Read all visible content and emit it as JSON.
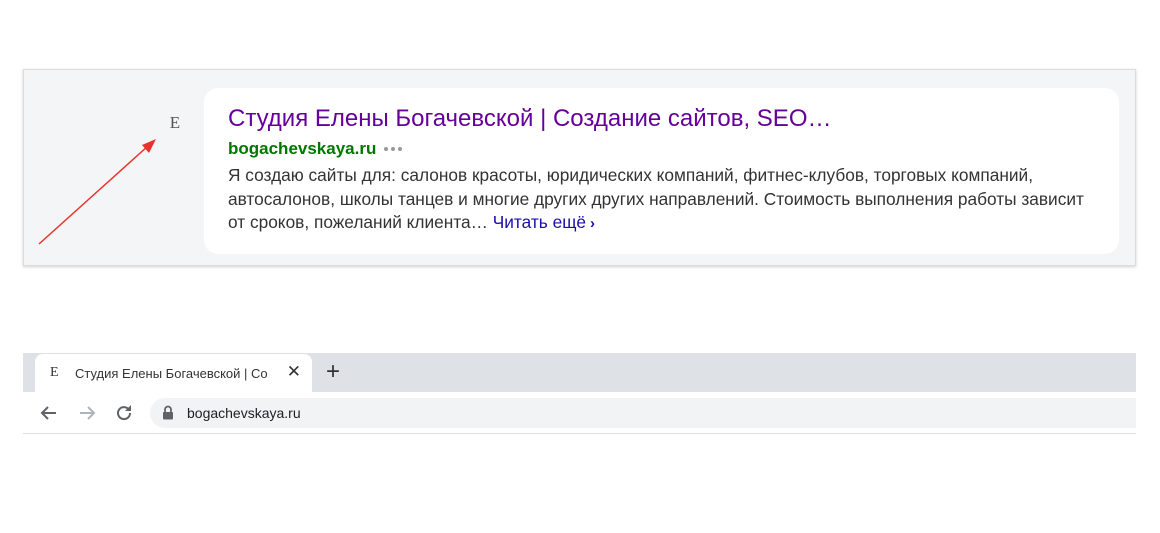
{
  "serp": {
    "favicon_letter": "E",
    "title": "Студия Елены Богачевской | Создание сайтов, SEO…",
    "url": "bogachevskaya.ru",
    "description": "Я создаю сайты для: салонов красоты, юридических компаний, фитнес-клубов, торговых компаний, автосалонов, школы танцев и многие других других направлений. Стоимость выполнения работы зависит от сроков, пожеланий клиента…",
    "read_more": "Читать ещё",
    "title_color": "#660099",
    "url_color": "#007700",
    "arrow_color": "#e8322c"
  },
  "browser": {
    "tab": {
      "favicon_letter": "E",
      "title": "Студия Елены Богачевской | Со",
      "close_icon": "close-icon"
    },
    "new_tab_symbol": "+",
    "nav": {
      "back_icon": "arrow-left-icon",
      "forward_icon": "arrow-right-icon",
      "reload_icon": "reload-icon"
    },
    "omnibox": {
      "url": "bogachevskaya.ru",
      "icon": "lock-icon"
    }
  }
}
